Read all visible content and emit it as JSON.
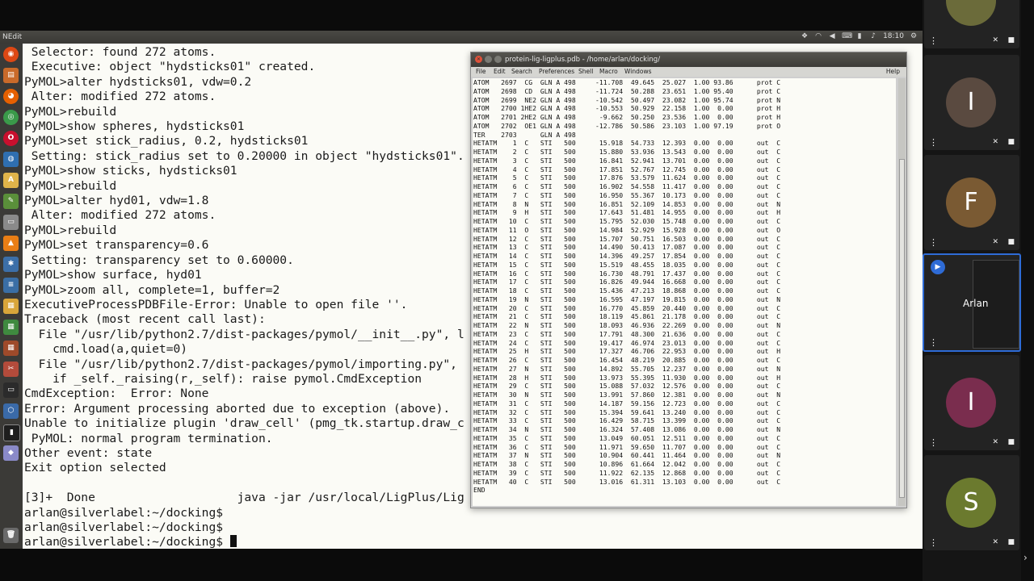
{
  "panel": {
    "app_name": "NEdit",
    "clock": "18:10"
  },
  "terminal": {
    "lines": [
      " Selector: found 272 atoms.",
      " Executive: object \"hydsticks01\" created.",
      "PyMOL>alter hydsticks01, vdw=0.2",
      " Alter: modified 272 atoms.",
      "PyMOL>rebuild",
      "PyMOL>show spheres, hydsticks01",
      "PyMOL>set stick_radius, 0.2, hydsticks01",
      " Setting: stick_radius set to 0.20000 in object \"hydsticks01\".",
      "PyMOL>show sticks, hydsticks01",
      "PyMOL>rebuild",
      "PyMOL>alter hyd01, vdw=1.8",
      " Alter: modified 272 atoms.",
      "PyMOL>rebuild",
      "PyMOL>set transparency=0.6",
      " Setting: transparency set to 0.60000.",
      "PyMOL>show surface, hyd01",
      "PyMOL>zoom all, complete=1, buffer=2",
      "ExecutiveProcessPDBFile-Error: Unable to open file ''.",
      "Traceback (most recent call last):",
      "  File \"/usr/lib/python2.7/dist-packages/pymol/__init__.py\", l",
      "    cmd.load(a,quiet=0)",
      "  File \"/usr/lib/python2.7/dist-packages/pymol/importing.py\",",
      "    if _self._raising(r,_self): raise pymol.CmdException",
      "CmdException:  Error: None",
      "Error: Argument processing aborted due to exception (above).",
      "Unable to initialize plugin 'draw_cell' (pmg_tk.startup.draw_c",
      " PyMOL: normal program termination.",
      "Other event: state",
      "Exit option selected",
      "",
      "[3]+  Done                    java -jar /usr/local/LigPlus/Lig",
      "arlan@silverlabel:~/docking$",
      "arlan@silverlabel:~/docking$",
      "arlan@silverlabel:~/docking$ "
    ]
  },
  "pdb_window": {
    "title": "protein-lig-ligplus.pdb - /home/arlan/docking/",
    "menu": [
      "File",
      "Edit",
      "Search",
      "Preferences",
      "Shell",
      "Macro",
      "Windows"
    ],
    "help": "Help",
    "lines": [
      "ATOM   2697  CG  GLN A 498     -11.708  49.645  25.027  1.00 93.86      prot C",
      "ATOM   2698  CD  GLN A 498     -11.724  50.288  23.651  1.00 95.40      prot C",
      "ATOM   2699  NE2 GLN A 498     -10.542  50.497  23.082  1.00 95.74      prot N",
      "ATOM   2700 1HE2 GLN A 498     -10.553  50.929  22.158  1.00  0.00      prot H",
      "ATOM   2701 2HE2 GLN A 498      -9.662  50.250  23.536  1.00  0.00      prot H",
      "ATOM   2702  OE1 GLN A 498     -12.786  50.586  23.103  1.00 97.19      prot O",
      "TER    2703      GLN A 498",
      "HETATM    1  C   STI   500      15.918  54.733  12.393  0.00  0.00      out  C",
      "HETATM    2  C   STI   500      15.880  53.936  13.543  0.00  0.00      out  C",
      "HETATM    3  C   STI   500      16.841  52.941  13.701  0.00  0.00      out  C",
      "HETATM    4  C   STI   500      17.851  52.767  12.745  0.00  0.00      out  C",
      "HETATM    5  C   STI   500      17.876  53.579  11.624  0.00  0.00      out  C",
      "HETATM    6  C   STI   500      16.902  54.558  11.417  0.00  0.00      out  C",
      "HETATM    7  C   STI   500      16.950  55.367  10.173  0.00  0.00      out  C",
      "HETATM    8  N   STI   500      16.851  52.109  14.853  0.00  0.00      out  N",
      "HETATM    9  H   STI   500      17.643  51.481  14.955  0.00  0.00      out  H",
      "HETATM   10  C   STI   500      15.795  52.030  15.748  0.00  0.00      out  C",
      "HETATM   11  O   STI   500      14.984  52.929  15.928  0.00  0.00      out  O",
      "HETATM   12  C   STI   500      15.707  50.751  16.503  0.00  0.00      out  C",
      "HETATM   13  C   STI   500      14.490  50.413  17.087  0.00  0.00      out  C",
      "HETATM   14  C   STI   500      14.396  49.257  17.854  0.00  0.00      out  C",
      "HETATM   15  C   STI   500      15.519  48.455  18.035  0.00  0.00      out  C",
      "HETATM   16  C   STI   500      16.730  48.791  17.437  0.00  0.00      out  C",
      "HETATM   17  C   STI   500      16.826  49.944  16.668  0.00  0.00      out  C",
      "HETATM   18  C   STI   500      15.436  47.213  18.868  0.00  0.00      out  C",
      "HETATM   19  N   STI   500      16.595  47.197  19.815  0.00  0.00      out  N",
      "HETATM   20  C   STI   500      16.770  45.859  20.440  0.00  0.00      out  C",
      "HETATM   21  C   STI   500      18.119  45.861  21.178  0.00  0.00      out  C",
      "HETATM   22  N   STI   500      18.093  46.936  22.269  0.00  0.00      out  N",
      "HETATM   23  C   STI   500      17.791  48.300  21.636  0.00  0.00      out  C",
      "HETATM   24  C   STI   500      19.417  46.974  23.013  0.00  0.00      out  C",
      "HETATM   25  H   STI   500      17.327  46.706  22.953  0.00  0.00      out  H",
      "HETATM   26  C   STI   500      16.454  48.219  20.885  0.00  0.00      out  C",
      "HETATM   27  N   STI   500      14.892  55.705  12.237  0.00  0.00      out  N",
      "HETATM   28  H   STI   500      13.973  55.395  11.930  0.00  0.00      out  H",
      "HETATM   29  C   STI   500      15.088  57.032  12.576  0.00  0.00      out  C",
      "HETATM   30  N   STI   500      13.991  57.860  12.381  0.00  0.00      out  N",
      "HETATM   31  C   STI   500      14.187  59.156  12.723  0.00  0.00      out  C",
      "HETATM   32  C   STI   500      15.394  59.641  13.240  0.00  0.00      out  C",
      "HETATM   33  C   STI   500      16.429  58.715  13.399  0.00  0.00      out  C",
      "HETATM   34  N   STI   500      16.324  57.408  13.086  0.00  0.00      out  N",
      "HETATM   35  C   STI   500      13.049  60.051  12.511  0.00  0.00      out  C",
      "HETATM   36  C   STI   500      11.971  59.650  11.707  0.00  0.00      out  C",
      "HETATM   37  N   STI   500      10.904  60.441  11.464  0.00  0.00      out  N",
      "HETATM   38  C   STI   500      10.896  61.664  12.042  0.00  0.00      out  C",
      "HETATM   39  C   STI   500      11.922  62.135  12.868  0.00  0.00      out  C",
      "HETATM   40  C   STI   500      13.016  61.311  13.103  0.00  0.00      out  C",
      "END"
    ]
  },
  "participants": [
    {
      "initial": "",
      "color": "#6b6b3a"
    },
    {
      "initial": "I",
      "color": "#5a4a40"
    },
    {
      "initial": "F",
      "color": "#7a5a33"
    },
    {
      "initial": "",
      "name": "Arlan",
      "color": "#2e6bd6"
    },
    {
      "initial": "I",
      "color": "#7a2d4e"
    },
    {
      "initial": "S",
      "color": "#6b7a2e"
    }
  ]
}
